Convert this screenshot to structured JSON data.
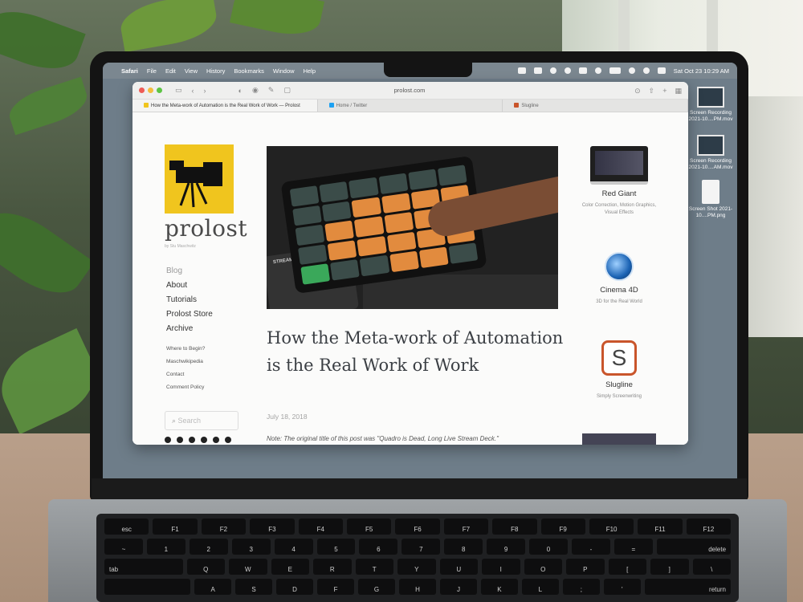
{
  "menubar": {
    "apple": "",
    "app": "Safari",
    "items": [
      "File",
      "Edit",
      "View",
      "History",
      "Bookmarks",
      "Window",
      "Help"
    ],
    "clock": "Sat Oct 23  10:29 AM"
  },
  "desktop": {
    "icons": [
      {
        "label": "Screen Recording 2021-10....PM.mov"
      },
      {
        "label": "Screen Recording 2021-10....AM.mov"
      },
      {
        "label": "Screen Shot 2021-10....PM.png"
      }
    ]
  },
  "safari": {
    "address": "prolost.com",
    "tabs": [
      {
        "label": "How the Meta-work of Automation is the Real Work of Work — Prolost",
        "favicon_color": "#f0c51e"
      },
      {
        "label": "Home / Twitter",
        "favicon_color": "#1da1f2"
      },
      {
        "label": "Slugline",
        "favicon_color": "#c9552b"
      }
    ]
  },
  "site": {
    "brand": "prolost",
    "byline": "by Stu Maschwitz",
    "nav_main": [
      "Blog",
      "About",
      "Tutorials",
      "Prolost Store",
      "Archive"
    ],
    "nav_sub": [
      "Where to Begin?",
      "Maschwikipedia",
      "Contact",
      "Comment Policy"
    ],
    "search_placeholder": "Search"
  },
  "article": {
    "title": "How the Meta-work of Automation is the Real Work of Work",
    "date": "July 18, 2018",
    "note": "Note: The original title of this post was \"Quadro is Dead, Long Live Stream Deck.\"",
    "hero_label": "STREAM DECK"
  },
  "sidebar_ads": [
    {
      "name": "Red Giant",
      "desc": "Color Correction, Motion Graphics, Visual Effects"
    },
    {
      "name": "Cinema 4D",
      "desc": "3D for the Real World"
    },
    {
      "name": "Slugline",
      "desc": "Simply Screenwriting",
      "glyph": "S"
    }
  ],
  "keyboard": {
    "row1": [
      "esc",
      "F1",
      "F2",
      "F3",
      "F4",
      "F5",
      "F6",
      "F7",
      "F8",
      "F9",
      "F10",
      "F11",
      "F12"
    ],
    "row2": [
      "~",
      "1",
      "2",
      "3",
      "4",
      "5",
      "6",
      "7",
      "8",
      "9",
      "0",
      "-",
      "=",
      "delete"
    ],
    "row3": [
      "tab",
      "Q",
      "W",
      "E",
      "R",
      "T",
      "Y",
      "U",
      "I",
      "O",
      "P",
      "[",
      "]",
      "\\"
    ],
    "row4": [
      "A",
      "S",
      "D",
      "F",
      "G",
      "H",
      "J",
      "K",
      "L",
      ";",
      "'",
      "return"
    ]
  }
}
